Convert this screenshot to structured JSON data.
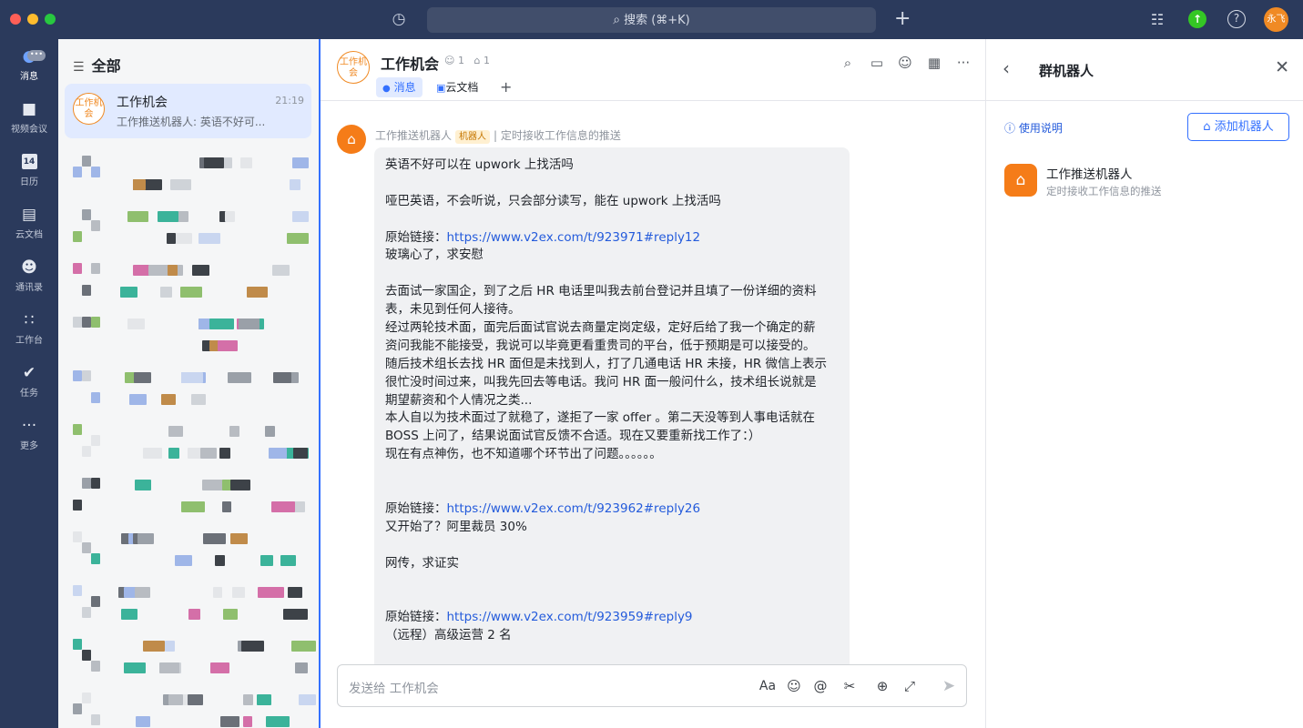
{
  "topbar": {
    "search_label": "搜索 (⌘+K)",
    "user_initials": "永飞"
  },
  "nav": {
    "items": [
      {
        "label": "消息",
        "icon": "chat-bubble-icon"
      },
      {
        "label": "视频会议",
        "icon": "video-camera-icon"
      },
      {
        "label": "日历",
        "icon": "calendar-icon"
      },
      {
        "label": "云文档",
        "icon": "cloud-doc-icon"
      },
      {
        "label": "通讯录",
        "icon": "contacts-icon"
      },
      {
        "label": "工作台",
        "icon": "workplace-grid-icon"
      },
      {
        "label": "任务",
        "icon": "task-check-icon"
      },
      {
        "label": "更多",
        "icon": "more-dots-icon"
      }
    ],
    "calendar_day": "14"
  },
  "conversation_list": {
    "header": "全部",
    "selected": {
      "avatar_text": "工作机会",
      "name": "工作机会",
      "time": "21:19",
      "preview": "工作推送机器人: 英语不好可..."
    }
  },
  "chat": {
    "avatar_text": "工作机会",
    "title": "工作机会",
    "member_count": "1",
    "bot_count": "1",
    "tabs": [
      "消息",
      "云文档"
    ],
    "message": {
      "sender": "工作推送机器人",
      "tag": "机器人",
      "description": "定时接收工作信息的推送",
      "lines": [
        {
          "text": "英语不好可以在 upwork 上找活吗"
        },
        {
          "gap": true
        },
        {
          "text": "哑巴英语，不会听说，只会部分读写，能在 upwork 上找活吗"
        },
        {
          "gap": true
        },
        {
          "prefix": "原始链接：",
          "link": "https://www.v2ex.com/t/923971#reply12"
        },
        {
          "text": "玻璃心了，求安慰"
        },
        {
          "gap": true
        },
        {
          "text": "去面试一家国企，到了之后 HR 电话里叫我去前台登记并且填了一份详细的资料"
        },
        {
          "text": "表，未见到任何人接待。"
        },
        {
          "text": "经过两轮技术面，面完后面试官说去商量定岗定级，定好后给了我一个确定的薪"
        },
        {
          "text": "资问我能不能接受，我说可以毕竟更看重贵司的平台，低于预期是可以接受的。"
        },
        {
          "text": "随后技术组长去找 HR 面但是未找到人，打了几通电话 HR 未接，HR 微信上表示"
        },
        {
          "text": "很忙没时间过来，叫我先回去等电话。我问 HR 面一般问什么，技术组长说就是"
        },
        {
          "text": "期望薪资和个人情况之类..."
        },
        {
          "text": "本人自以为技术面过了就稳了，遂拒了一家 offer 。第二天没等到人事电话就在"
        },
        {
          "text": "BOSS 上问了，结果说面试官反馈不合适。现在又要重新找工作了：）"
        },
        {
          "text": "现在有点神伤，也不知道哪个环节出了问题。。。。。。"
        },
        {
          "gap": true
        },
        {
          "gap": true
        },
        {
          "prefix": "原始链接：",
          "link": "https://www.v2ex.com/t/923962#reply26"
        },
        {
          "text": "又开始了？阿里裁员 30%"
        },
        {
          "gap": true
        },
        {
          "text": "网传，求证实"
        },
        {
          "gap": true
        },
        {
          "gap": true
        },
        {
          "prefix": "原始链接：",
          "link": "https://www.v2ex.com/t/923959#reply9"
        },
        {
          "text": "（远程）高级运营 2 名"
        }
      ]
    },
    "input_placeholder": "发送给 工作机会",
    "input_format_label": "Aa"
  },
  "bot_panel": {
    "title": "群机器人",
    "usage_label": "使用说明",
    "add_button": "添加机器人",
    "bot": {
      "name": "工作推送机器人",
      "description": "定时接收工作信息的推送"
    }
  },
  "colors": {
    "sidebar_bg": "#2b3a5c",
    "accent": "#3370ff",
    "bot_orange": "#f57c18",
    "selected_conv": "#e1eaff"
  }
}
